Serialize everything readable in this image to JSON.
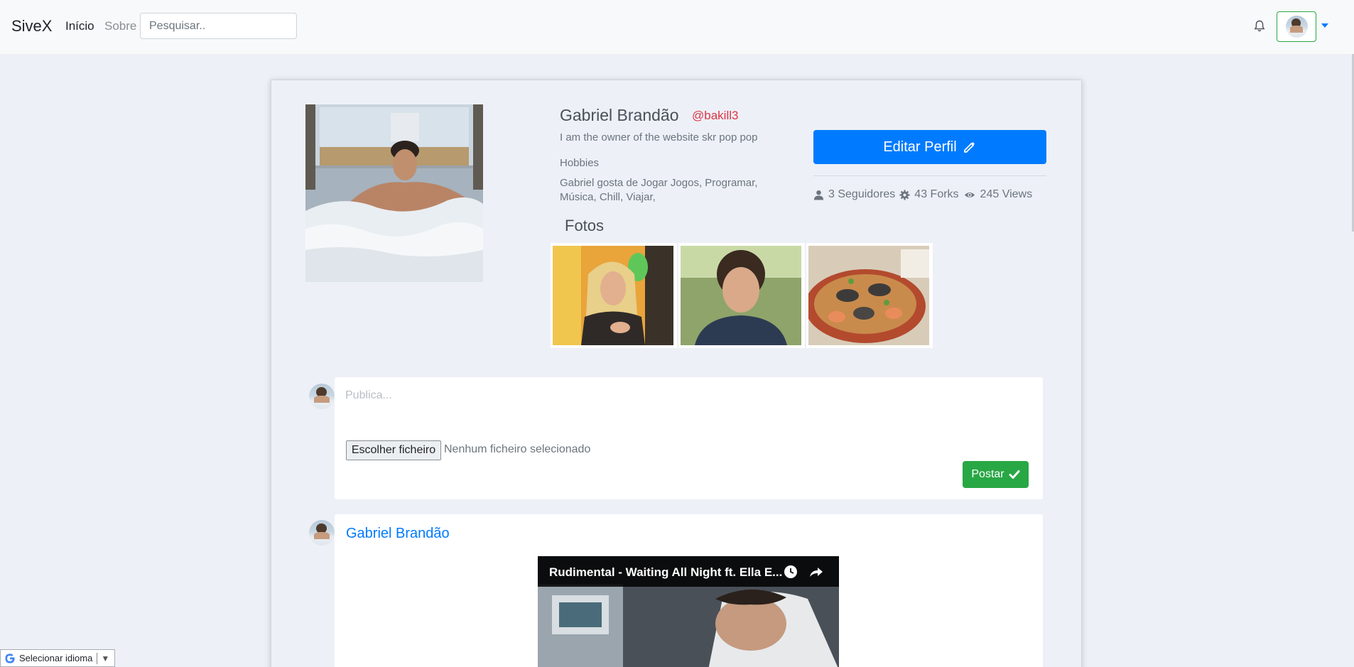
{
  "navbar": {
    "brand": "SiveX",
    "links": [
      "Início",
      "Sobre"
    ],
    "search_placeholder": "Pesquisar.."
  },
  "profile": {
    "name": "Gabriel Brandão",
    "handle": "@bakill3",
    "bio": "I am the owner of the website skr pop pop",
    "hobbies_title": "Hobbies",
    "hobbies_text": "Gabriel gosta de Jogar Jogos, Programar, Música, Chill, Viajar,",
    "edit_label": "Editar Perfil",
    "stats": {
      "followers": "3 Seguidores",
      "forks": "43 Forks",
      "views": "245 Views"
    },
    "photos_title": "Fotos"
  },
  "composer": {
    "placeholder": "Publica...",
    "file_button": "Escolher ficheiro",
    "file_status": "Nenhum ficheiro selecionado",
    "post_button": "Postar"
  },
  "post": {
    "author": "Gabriel Brandão",
    "video_title": "Rudimental - Waiting All Night ft. Ella E..."
  },
  "translate": {
    "label": "Selecionar idioma"
  },
  "colors": {
    "primary": "#007bff",
    "success": "#28a745",
    "danger": "#dc3545",
    "page_bg": "#edf0f7"
  },
  "icons": [
    "bell-icon",
    "pencil-icon",
    "user-icon",
    "cog-icon",
    "eye-icon",
    "check-icon",
    "clock-icon",
    "share-icon",
    "google-icon"
  ]
}
